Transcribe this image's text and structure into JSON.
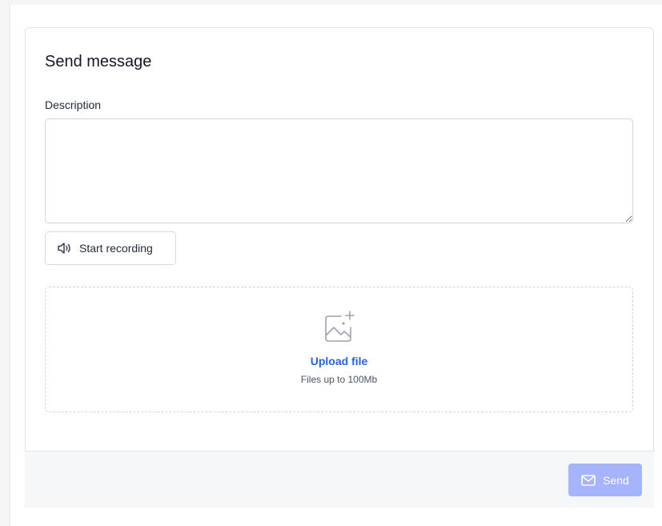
{
  "card": {
    "title": "Send message"
  },
  "description": {
    "label": "Description",
    "value": "",
    "placeholder": ""
  },
  "recording": {
    "label": "Start recording",
    "icon": "speaker-icon"
  },
  "upload": {
    "icon": "image-add-icon",
    "link_label": "Upload file",
    "hint": "Files up to 100Mb"
  },
  "footer": {
    "send_label": "Send",
    "send_icon": "envelope-icon"
  },
  "colors": {
    "primary_disabled": "#a5b4fc",
    "link": "#2563eb",
    "footer_bg": "#f6f7f9"
  }
}
